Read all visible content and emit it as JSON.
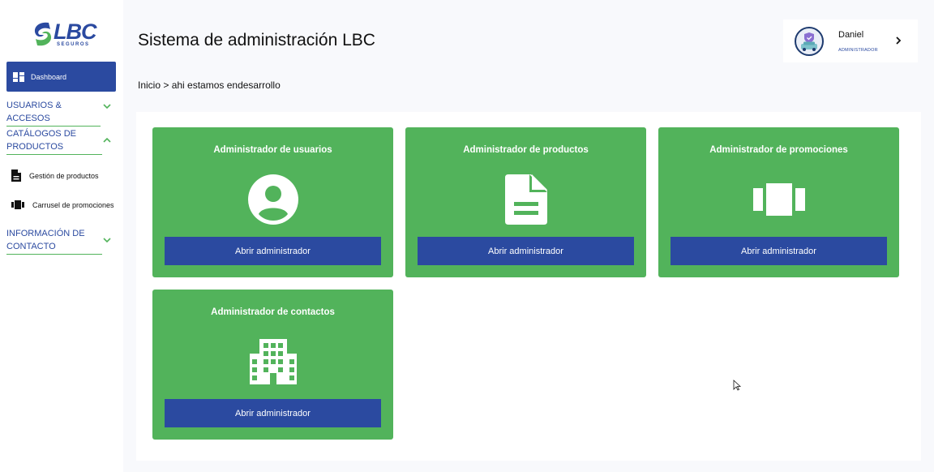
{
  "brand": {
    "logo_text": "LBC",
    "logo_subtext": "SEGUROS",
    "colors": {
      "primary": "#2b4aa0",
      "accent": "#52b35b"
    }
  },
  "sidebar": {
    "dashboard": {
      "label": "Dashboard",
      "icon": "dashboard-icon"
    },
    "sections": [
      {
        "title": "USUARIOS & ACCESOS",
        "expanded": false
      },
      {
        "title": "CATÁLOGOS DE PRODUCTOS",
        "expanded": true,
        "items": [
          {
            "label": "Gestión de productos",
            "icon": "document-icon"
          },
          {
            "label": "Carrusel de promociones",
            "icon": "carousel-icon"
          }
        ]
      },
      {
        "title": "INFORMACIÓN DE CONTACTO",
        "expanded": false
      }
    ]
  },
  "header": {
    "title": "Sistema de administración LBC",
    "breadcrumb": "Inicio > ahi estamos endesarrollo"
  },
  "user": {
    "name": "Daniel",
    "role": "ADMINISTRADOR"
  },
  "cards": [
    {
      "title": "Administrador de usuarios",
      "icon": "user-circle-icon",
      "button": "Abrir administrador"
    },
    {
      "title": "Administrador de productos",
      "icon": "document-icon",
      "button": "Abrir administrador"
    },
    {
      "title": "Administrador de promociones",
      "icon": "carousel-icon",
      "button": "Abrir administrador"
    },
    {
      "title": "Administrador de contactos",
      "icon": "building-icon",
      "button": "Abrir administrador"
    }
  ]
}
